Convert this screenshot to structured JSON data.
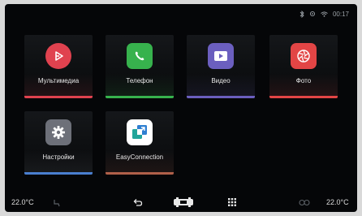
{
  "status_bar": {
    "time": "00:17",
    "icons": [
      "bluetooth-icon",
      "phone-signal-icon",
      "wifi-icon"
    ]
  },
  "apps": [
    {
      "label": "Мультимедиа",
      "icon": "multimedia-play-icon",
      "color": "#e0424f"
    },
    {
      "label": "Телефон",
      "icon": "phone-handset-icon",
      "color": "#37b24d"
    },
    {
      "label": "Видео",
      "icon": "video-play-icon",
      "color": "#6b5fbf"
    },
    {
      "label": "Фото",
      "icon": "photo-aperture-icon",
      "color": "#e24545"
    },
    {
      "label": "Настройки",
      "icon": "settings-gear-icon",
      "color": "#6d7079"
    },
    {
      "label": "EasyConnection",
      "icon": "easyconnection-icon",
      "color": "#22a59a"
    }
  ],
  "bottom_bar": {
    "temp_left": "22.0°C",
    "temp_right": "22.0°C",
    "icons": [
      "seat-icon",
      "back-icon",
      "car-icon",
      "grid-menu-icon",
      "fan-icon"
    ]
  }
}
